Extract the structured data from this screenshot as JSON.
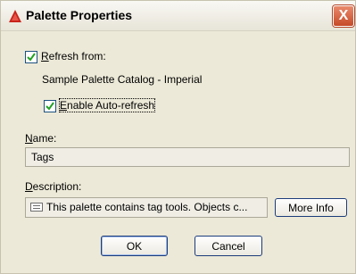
{
  "window": {
    "title": "Palette Properties",
    "close_label": "X"
  },
  "refresh": {
    "checked": true,
    "label": "Refresh from:",
    "source": "Sample Palette Catalog - Imperial"
  },
  "auto_refresh": {
    "checked": true,
    "label": "Enable Auto-refresh"
  },
  "name": {
    "label": "Name:",
    "value": "Tags"
  },
  "description": {
    "label": "Description:",
    "value": "This palette contains tag tools. Objects c..."
  },
  "buttons": {
    "more_info": "More Info",
    "ok": "OK",
    "cancel": "Cancel"
  }
}
